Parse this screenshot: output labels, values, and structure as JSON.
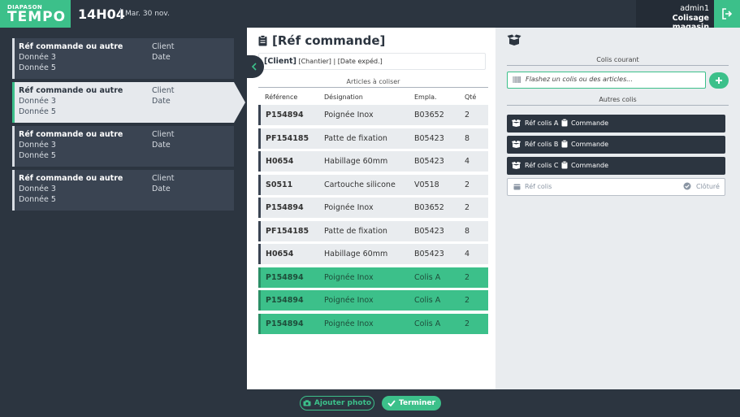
{
  "header": {
    "logo_small": "DIAPASON",
    "logo_big": "TEMPO",
    "time": "14H04",
    "date": "Mar. 30 nov.",
    "user": "admin1",
    "app_name": "Colisage magasin"
  },
  "orders": [
    {
      "ref": "Réf commande ou autre",
      "client": "Client",
      "data3": "Donnée 3",
      "date": "Date",
      "data5": "Donnée 5",
      "active": false
    },
    {
      "ref": "Réf commande ou autre",
      "client": "Client",
      "data3": "Donnée 3",
      "date": "Date",
      "data5": "Donnée 5",
      "active": true
    },
    {
      "ref": "Réf commande ou autre",
      "client": "Client",
      "data3": "Donnée 3",
      "date": "Date",
      "data5": "Donnée 5",
      "active": false
    },
    {
      "ref": "Réf commande ou autre",
      "client": "Client",
      "data3": "Donnée 3",
      "date": "Date",
      "data5": "Donnée 5",
      "active": false
    }
  ],
  "order_detail": {
    "title": "[Réf commande]",
    "client": "[Client]",
    "chantier": "[Chantier]",
    "date_exped": "[Date expéd.]",
    "separator": "|",
    "articles_label": "Articles à coliser",
    "columns": {
      "ref": "Référence",
      "designation": "Désignation",
      "empla": "Empla.",
      "qte": "Qté"
    },
    "rows": [
      {
        "ref": "P154894",
        "designation": "Poignée Inox",
        "empla": "B03652",
        "qte": "2",
        "done": false
      },
      {
        "ref": "PF154185",
        "designation": "Patte de fixation",
        "empla": "B05423",
        "qte": "8",
        "done": false
      },
      {
        "ref": "H0654",
        "designation": "Habillage 60mm",
        "empla": "B05423",
        "qte": "4",
        "done": false
      },
      {
        "ref": "S0511",
        "designation": "Cartouche silicone",
        "empla": "V0518",
        "qte": "2",
        "done": false
      },
      {
        "ref": "P154894",
        "designation": "Poignée Inox",
        "empla": "B03652",
        "qte": "2",
        "done": false
      },
      {
        "ref": "PF154185",
        "designation": "Patte de fixation",
        "empla": "B05423",
        "qte": "8",
        "done": false
      },
      {
        "ref": "H0654",
        "designation": "Habillage 60mm",
        "empla": "B05423",
        "qte": "4",
        "done": false
      },
      {
        "ref": "P154894",
        "designation": "Poignée Inox",
        "empla": "Colis A",
        "qte": "2",
        "done": true
      },
      {
        "ref": "P154894",
        "designation": "Poignée Inox",
        "empla": "Colis A",
        "qte": "2",
        "done": true
      },
      {
        "ref": "P154894",
        "designation": "Poignée Inox",
        "empla": "Colis A",
        "qte": "2",
        "done": true
      }
    ]
  },
  "colis": {
    "current_label": "Colis courant",
    "scan_placeholder": "Flashez un colis ou des articles...",
    "others_label": "Autres colis",
    "others": [
      {
        "ref": "Réf colis A",
        "commande": "Commande"
      },
      {
        "ref": "Réf colis B",
        "commande": "Commande"
      },
      {
        "ref": "Réf colis C",
        "commande": "Commande"
      }
    ],
    "new_ref_placeholder": "Réf colis",
    "close_label": "Clôturé"
  },
  "footer": {
    "photo_label": "Ajouter photo",
    "finish_label": "Terminer"
  },
  "colors": {
    "accent": "#3cc08a",
    "dark": "#2c3540"
  }
}
